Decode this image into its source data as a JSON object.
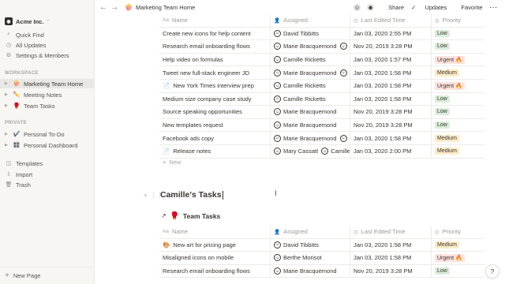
{
  "workspace": {
    "name": "Acme Inc."
  },
  "sidebar": {
    "top_items": [
      {
        "label": "Quick Find",
        "icon": "search-icon"
      },
      {
        "label": "All Updates",
        "icon": "clock-icon"
      },
      {
        "label": "Settings & Members",
        "icon": "gear-icon"
      }
    ],
    "workspace_label": "WORKSPACE",
    "workspace_items": [
      {
        "label": "Marketing Team Home",
        "emoji": "🍿",
        "active": true
      },
      {
        "label": "Meeting Notes",
        "emoji": "✏️"
      },
      {
        "label": "Team Tasks",
        "emoji": "🥊"
      }
    ],
    "private_label": "PRIVATE",
    "private_items": [
      {
        "label": "Personal To-Do",
        "emoji": "✔️"
      },
      {
        "label": "Personal Dashboard",
        "emoji": "🎛️"
      }
    ],
    "bottom_items": [
      {
        "label": "Templates",
        "icon": "template-icon"
      },
      {
        "label": "Import",
        "icon": "import-icon"
      },
      {
        "label": "Trash",
        "icon": "trash-icon"
      }
    ],
    "new_page": "New Page"
  },
  "topbar": {
    "breadcrumb": "Marketing Team Home",
    "breadcrumb_emoji": "🍿",
    "share": "Share",
    "updates": "Updates",
    "favorite": "Favorite"
  },
  "table_columns": [
    "Name",
    "Assigned",
    "Last Edited Time",
    "Priority"
  ],
  "table1_rows": [
    {
      "name": "Create new icons for help content",
      "assigned": [
        "David Tibbitts"
      ],
      "edited": "Jan 03, 2020 2:55 PM",
      "priority": "Low"
    },
    {
      "name": "Research email onboarding flows",
      "assigned": [
        "Marie Bracquemond",
        "B"
      ],
      "edited": "Nov 20, 2019 3:28 PM",
      "priority": "Low"
    },
    {
      "name": "Help video on formulas",
      "assigned": [
        "Camille Ricketts"
      ],
      "edited": "Jan 03, 2020 1:57 PM",
      "priority": "Urgent 🔥"
    },
    {
      "name": "Tweet new full-stack engineer JD",
      "assigned": [
        "Marie Bracquemond",
        "C"
      ],
      "edited": "Jan 03, 2020 1:58 PM",
      "priority": "Medium"
    },
    {
      "name": "New York Times interview prep",
      "assigned": [
        "Camille Ricketts"
      ],
      "edited": "Jan 03, 2020 1:58 PM",
      "priority": "Urgent 🔥",
      "page_icon": true
    },
    {
      "name": "Medium size company case study",
      "assigned": [
        "Camille Ricketts"
      ],
      "edited": "Jan 03, 2020 1:58 PM",
      "priority": "Low"
    },
    {
      "name": "Source speaking opportunities",
      "assigned": [
        "Marie Bracquemond"
      ],
      "edited": "Nov 20, 2019 3:28 PM",
      "priority": "Low"
    },
    {
      "name": "New templates request",
      "assigned": [
        "Marie Bracquemond"
      ],
      "edited": "Nov 20, 2019 3:28 PM",
      "priority": "Low"
    },
    {
      "name": "Facebook ads copy",
      "assigned": [
        "Marie Bracquemond",
        "E"
      ],
      "edited": "Jan 03, 2020 1:58 PM",
      "priority": "Medium"
    },
    {
      "name": "Release notes",
      "assigned": [
        "Mary Cassatt",
        "Camille"
      ],
      "edited": "Jan 03, 2020 2:00 PM",
      "priority": "Medium",
      "page_icon": true
    }
  ],
  "new_label": "New",
  "section_title": "Camille's Tasks",
  "linked_db": {
    "title": "Team Tasks",
    "emoji": "🥊"
  },
  "table2_rows": [
    {
      "name": "New art for pricing page",
      "assigned": [
        "David Tibbitts"
      ],
      "edited": "Jan 03, 2020 1:58 PM",
      "priority": "Medium",
      "emoji": "🎨"
    },
    {
      "name": "Misaligned icons on mobile",
      "assigned": [
        "Berthe Morisot"
      ],
      "edited": "Jan 03, 2020 1:58 PM",
      "priority": "Urgent 🔥"
    },
    {
      "name": "Research email onboarding flows",
      "assigned": [
        "Marie Bracquemond"
      ],
      "edited": "Nov 20, 2019 3:28 PM",
      "priority": "Low"
    }
  ],
  "help": "?",
  "colors": {
    "sidebar_bg": "#f7f6f3",
    "low": "#dbeddb",
    "medium": "#fdecc8",
    "urgent": "#ffe2dd"
  }
}
